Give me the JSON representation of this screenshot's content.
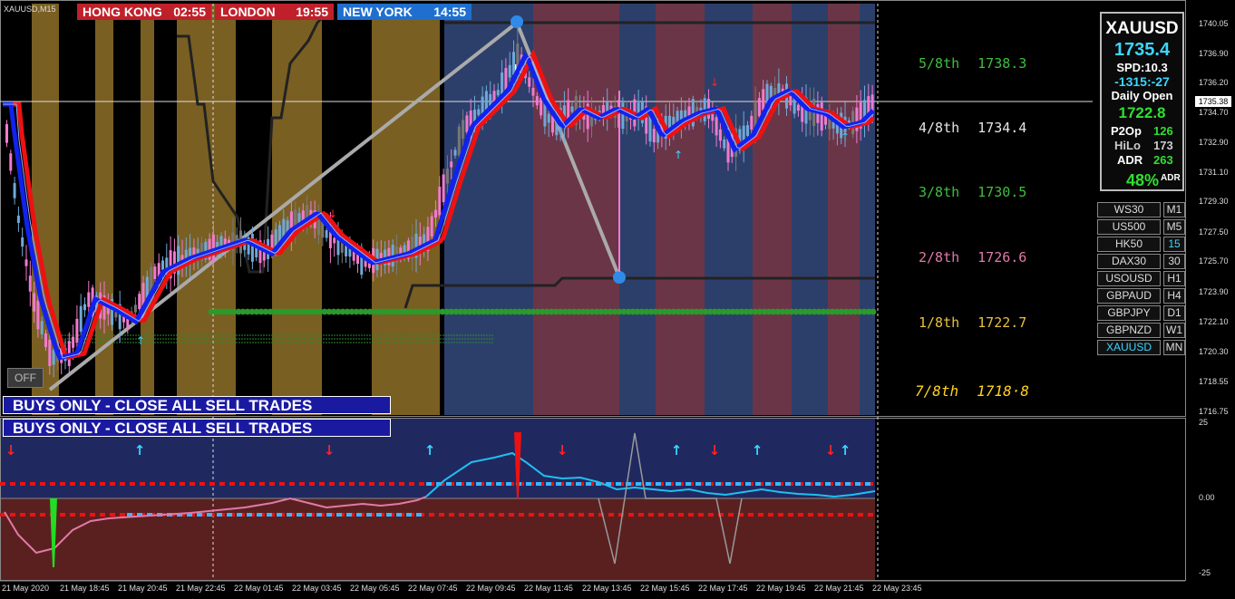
{
  "symbol_label": "XAUUSD,M15",
  "sessions": [
    {
      "city": "HONG KONG",
      "time": "02:55",
      "color": "#c0202a"
    },
    {
      "city": "LONDON",
      "time": "19:55",
      "color": "#c0202a"
    },
    {
      "city": "NEW YORK",
      "time": "14:55",
      "color": "#1f6fd0"
    }
  ],
  "banners": {
    "top": "BUYS ONLY - CLOSE ALL SELL TRADES",
    "bottom": "BUYS ONLY - CLOSE ALL SELL TRADES"
  },
  "off_button": "OFF",
  "murray_levels": [
    {
      "label": "5/8th",
      "price": "1738.3",
      "color": "#3fbf3f"
    },
    {
      "label": "4/8th",
      "price": "1734.4",
      "color": "#e6e6e6"
    },
    {
      "label": "3/8th",
      "price": "1730.5",
      "color": "#3fbf3f"
    },
    {
      "label": "2/8th",
      "price": "1726.6",
      "color": "#e07aa8"
    },
    {
      "label": "1/8th",
      "price": "1722.7",
      "color": "#e8c040"
    },
    {
      "label": "7/8th",
      "price": "1718·8",
      "color": "#ffd21f"
    }
  ],
  "info_panel": {
    "symbol": "XAUUSD",
    "price": "1735.4",
    "spread": "SPD:10.3",
    "countdown": "-1315:-27",
    "daily_open_label": "Daily Open",
    "daily_open": "1722.8",
    "p2op_label": "P2Op",
    "p2op": "126",
    "hilo_label": "HiLo",
    "hilo": "173",
    "adr_label": "ADR",
    "adr": "263",
    "adr_pct": "48%",
    "adr_pct_suffix": "ADR"
  },
  "symbol_buttons": [
    "WS30",
    "US500",
    "HK50",
    "DAX30",
    "USOUSD",
    "GBPAUD",
    "GBPJPY",
    "GBPNZD",
    "XAUUSD"
  ],
  "timeframe_buttons": [
    "M1",
    "M5",
    "15",
    "30",
    "H1",
    "H4",
    "D1",
    "W1",
    "MN"
  ],
  "current_price_tag": "1735.38",
  "price_axis": [
    "1740.05",
    "1736.90",
    "1736.20",
    "1734.70",
    "1732.90",
    "1731.10",
    "1729.30",
    "1727.50",
    "1725.70",
    "1723.90",
    "1722.10",
    "1720.30",
    "1718.55",
    "1716.75"
  ],
  "osc_axis": [
    "25",
    "0.00",
    "-25"
  ],
  "time_axis": [
    "21 May 2020",
    "21 May 18:45",
    "21 May 20:45",
    "21 May 22:45",
    "22 May 01:45",
    "22 May 03:45",
    "22 May 05:45",
    "22 May 07:45",
    "22 May 09:45",
    "22 May 11:45",
    "22 May 13:45",
    "22 May 15:45",
    "22 May 17:45",
    "22 May 19:45",
    "22 May 21:45",
    "22 May 23:45"
  ],
  "colors": {
    "bull_candle": "#6fa8d8",
    "bear_candle": "#f07ad0",
    "ma_red": "#ee1111",
    "ma_blue": "#1122ee",
    "daily_open_line": "#2a9a2a"
  }
}
